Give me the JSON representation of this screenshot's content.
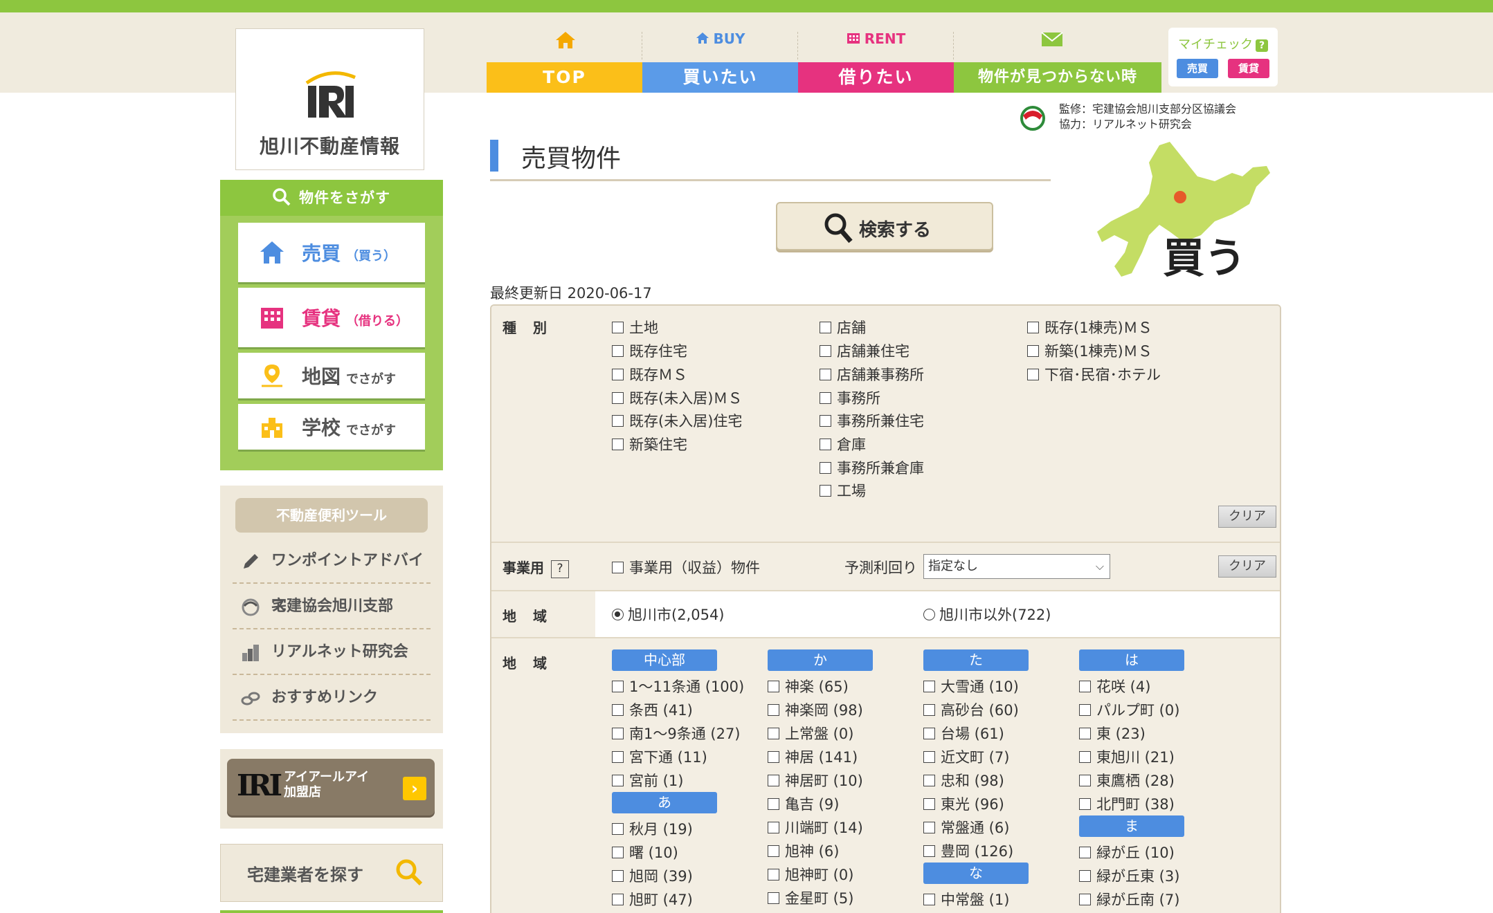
{
  "logo": {
    "title": "旭川不動産情報",
    "mark_text": "IRI"
  },
  "nav": [
    {
      "top_label": "",
      "label": "TOP",
      "bar_color": "#fbbf19",
      "icon_color": "#f5a800",
      "icon": "home-icon"
    },
    {
      "top_label": "BUY",
      "label": "買いたい",
      "bar_color": "#5b9be8",
      "icon_color": "#4d8de0",
      "icon": "home-icon"
    },
    {
      "top_label": "RENT",
      "label": "借りたい",
      "bar_color": "#e6327f",
      "icon_color": "#e6327f",
      "icon": "building-icon"
    },
    {
      "top_label": "",
      "label": "物件が見つからない時",
      "bar_color": "#8dc63f",
      "icon_color": "#8dc63f",
      "icon": "mail-icon"
    }
  ],
  "mycheck": {
    "title": "マイチェック",
    "q": "?",
    "buy": "売買",
    "rent": "賃貸"
  },
  "supervise": {
    "line1": "監修：宅建協会旭川支部分区協議会",
    "line2": "協力：リアルネット研究会"
  },
  "sidebar": {
    "search_title": "物件をさがす",
    "buttons": [
      {
        "main": "売買",
        "sub": "（買う）",
        "color": "#4d8de0",
        "icon": "home-icon"
      },
      {
        "main": "賃貸",
        "sub": "（借りる）",
        "color": "#e6327f",
        "icon": "building-icon"
      },
      {
        "main": "地図",
        "sub": "でさがす",
        "color": "#555555",
        "icon": "map-pin-icon"
      },
      {
        "main": "学校",
        "sub": "でさがす",
        "color": "#555555",
        "icon": "school-icon"
      }
    ],
    "tools_title": "不動産便利ツール",
    "tools": [
      "ワンポイントアドバイス",
      "宅建協会旭川支部",
      "リアルネット研究会",
      "おすすめリンク"
    ],
    "iri_logo": "IRI",
    "iri_line1": "アイアールアイ",
    "iri_line2": "加盟店",
    "iri_arrow": "›",
    "agent_search": "宅建業者を探す"
  },
  "page_title": "売買物件",
  "search_button": "検索する",
  "map_label": "買う",
  "updated": "最終更新日 2020-06-17",
  "form": {
    "type_label": "種　別",
    "types_col1": [
      "土地",
      "既存住宅",
      "既存ＭＳ",
      "既存(未入居)ＭＳ",
      "既存(未入居)住宅",
      "新築住宅"
    ],
    "types_col2": [
      "店舗",
      "店舗兼住宅",
      "店舗兼事務所",
      "事務所",
      "事務所兼住宅",
      "倉庫",
      "事務所兼倉庫",
      "工場"
    ],
    "types_col3": [
      "既存(1棟売)ＭＳ",
      "新築(1棟売)ＭＳ",
      "下宿･民宿･ホテル"
    ],
    "clear": "クリア",
    "business_label": "事業用",
    "business_q": "?",
    "business_check": "事業用（収益）物件",
    "yield_label": "予測利回り",
    "yield_value": "指定なし",
    "region_label": "地　域",
    "region_radio1": "旭川市(2,054)",
    "region_radio2": "旭川市以外(722)",
    "area_label": "地　域",
    "areas": {
      "col1_head": "中心部",
      "col1_items": [
        "1～11条通 (100)",
        "条西 (41)",
        "南1～9条通 (27)",
        "宮下通 (11)",
        "宮前 (1)"
      ],
      "col1_head2": "あ",
      "col1_items2": [
        "秋月 (19)",
        "曙 (10)",
        "旭岡 (39)",
        "旭町 (47)"
      ],
      "col2_head": "か",
      "col2_items": [
        "神楽 (65)",
        "神楽岡 (98)",
        "上常盤 (0)",
        "神居 (141)",
        "神居町 (10)",
        "亀吉 (9)",
        "川端町 (14)",
        "旭神 (6)",
        "旭神町 (0)",
        "金星町 (5)"
      ],
      "col3_head": "た",
      "col3_items": [
        "大雪通 (10)",
        "高砂台 (60)",
        "台場 (61)",
        "近文町 (7)",
        "忠和 (98)",
        "東光 (96)",
        "常盤通 (6)",
        "豊岡 (126)"
      ],
      "col3_head2": "な",
      "col3_items2": [
        "中常盤 (1)"
      ],
      "col4_head": "は",
      "col4_items": [
        "花咲 (4)",
        "パルプ町 (0)",
        "東 (23)",
        "東旭川 (21)",
        "東鷹栖 (28)",
        "北門町 (38)"
      ],
      "col4_head2": "ま",
      "col4_items2": [
        "緑が丘 (10)",
        "緑が丘東 (3)",
        "緑が丘南 (7)"
      ]
    }
  }
}
